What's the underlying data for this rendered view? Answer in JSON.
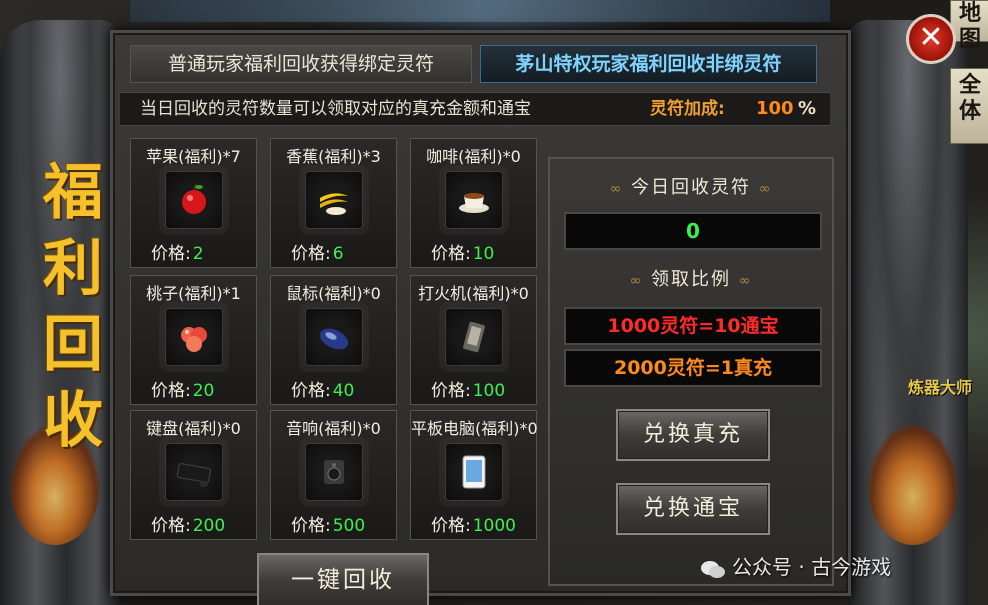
{
  "side_tabs": {
    "map": "地图",
    "all": "全体"
  },
  "tabs": {
    "normal": "普通玩家福利回收获得绑定灵符",
    "vip": "茅山特权玩家福利回收非绑灵符"
  },
  "notice": {
    "text": "当日回收的灵符数量可以领取对应的真充金额和通宝",
    "bonus_label": "灵符加成:",
    "bonus_value": "100",
    "bonus_pct": "%"
  },
  "vertical_title": [
    "福",
    "利",
    "回",
    "收"
  ],
  "price_label": "价格:",
  "items": [
    {
      "name": "苹果(福利)*7",
      "price": "2",
      "icon": "apple-icon"
    },
    {
      "name": "香蕉(福利)*3",
      "price": "6",
      "icon": "banana-icon"
    },
    {
      "name": "咖啡(福利)*0",
      "price": "10",
      "icon": "coffee-icon"
    },
    {
      "name": "桃子(福利)*1",
      "price": "20",
      "icon": "peach-icon"
    },
    {
      "name": "鼠标(福利)*0",
      "price": "40",
      "icon": "mouse-icon"
    },
    {
      "name": "打火机(福利)*0",
      "price": "100",
      "icon": "lighter-icon"
    },
    {
      "name": "键盘(福利)*0",
      "price": "200",
      "icon": "keyboard-icon"
    },
    {
      "name": "音响(福利)*0",
      "price": "500",
      "icon": "speaker-icon"
    },
    {
      "name": "平板电脑(福利)*0",
      "price": "1000",
      "icon": "tablet-icon"
    }
  ],
  "right_panel": {
    "today_title": "今日回收灵符",
    "today_value": "0",
    "ratio_title": "领取比例",
    "ratio_1": "1000灵符=10通宝",
    "ratio_2": "2000灵符=1真充",
    "btn_recharge": "兑换真充",
    "btn_tongbao": "兑换通宝"
  },
  "onekey_button": "一键回收",
  "close_button": "✕",
  "npc_label": "炼器大师",
  "watermark": "公众号 · 古今游戏",
  "colors": {
    "gold": "#f4c12a",
    "green": "#3cf050",
    "red": "#ff3030",
    "orange": "#ff8a1c",
    "blue": "#7ed4ff"
  }
}
